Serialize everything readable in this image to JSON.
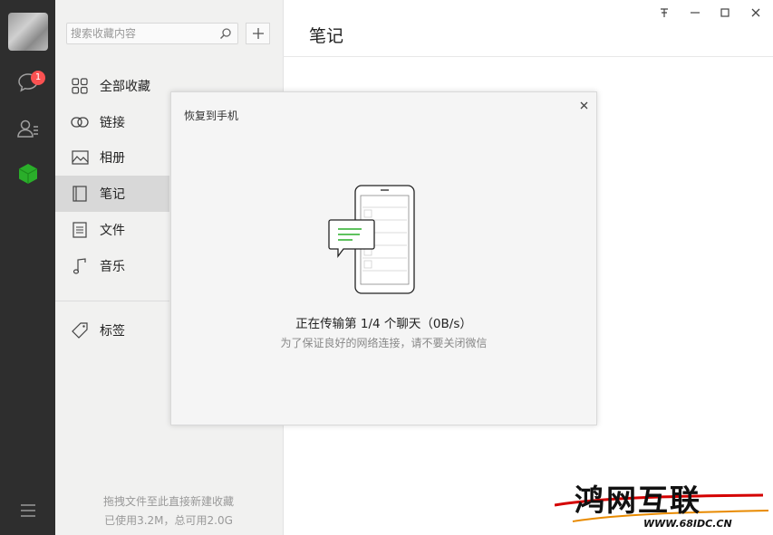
{
  "nav": {
    "badge_count": "1",
    "icons": [
      "chat-icon",
      "contacts-icon",
      "favorites-cube-icon",
      "menu-icon"
    ]
  },
  "sidebar": {
    "search_placeholder": "搜索收藏内容",
    "items": [
      {
        "label": "全部收藏",
        "icon": "grid-icon"
      },
      {
        "label": "链接",
        "icon": "link-icon"
      },
      {
        "label": "相册",
        "icon": "image-icon"
      },
      {
        "label": "笔记",
        "icon": "note-icon",
        "selected": true
      },
      {
        "label": "文件",
        "icon": "file-icon"
      },
      {
        "label": "音乐",
        "icon": "music-icon"
      },
      {
        "label": "标签",
        "icon": "tag-icon"
      }
    ],
    "footer_hint": "拖拽文件至此直接新建收藏",
    "footer_usage": "已使用3.2M，总可用2.0G"
  },
  "main": {
    "title": "笔记"
  },
  "dialog": {
    "title": "恢复到手机",
    "status": "正在传输第 1/4 个聊天（0B/s）",
    "hint": "为了保证良好的网络连接，请不要关闭微信"
  },
  "watermark": {
    "brand": "鸿网互联",
    "url": "WWW.68IDC.CN"
  },
  "colors": {
    "nav_bg": "#2e2e2e",
    "accent_green": "#2aae2a",
    "badge_red": "#fa5151"
  }
}
